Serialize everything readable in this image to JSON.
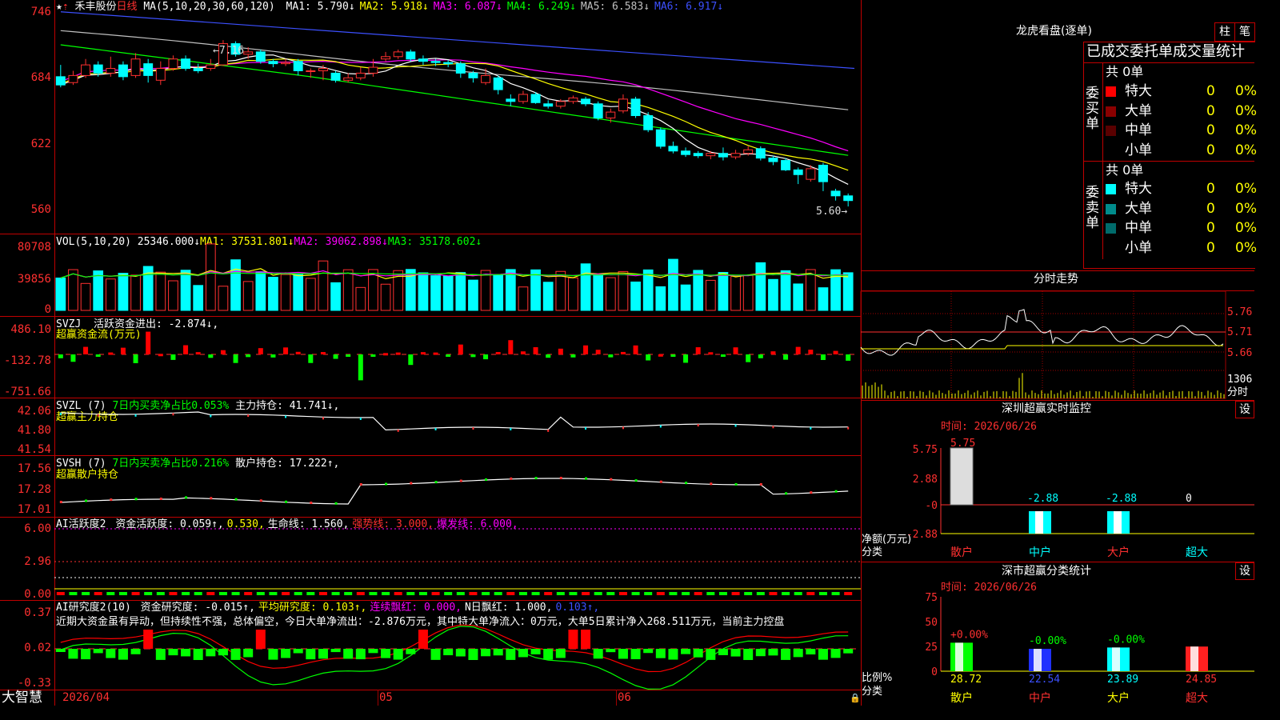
{
  "stock": {
    "name": "禾丰股份",
    "period": "日线"
  },
  "header_ma": {
    "label": "MA(5,10,20,30,60,120)",
    "items": [
      {
        "text": "MA1: 5.790↓",
        "color": "#ffffff"
      },
      {
        "text": "MA2: 5.918↓",
        "color": "#ffff00"
      },
      {
        "text": "MA3: 6.087↓",
        "color": "#ff00ff"
      },
      {
        "text": "MA4: 6.249↓",
        "color": "#00ff00"
      },
      {
        "text": "MA5: 6.583↓",
        "color": "#c0c0c0"
      },
      {
        "text": "MA6: 6.917↓",
        "color": "#3c50ff"
      }
    ]
  },
  "price_axis": [
    "746",
    "684",
    "622",
    "560"
  ],
  "price_marks": {
    "high": "7.16",
    "low": "5.60"
  },
  "vol": {
    "label": "VOL(5,10,20)",
    "value": "25346.000↓",
    "ma": [
      {
        "text": "MA1: 37531.801↓",
        "color": "#ffff00"
      },
      {
        "text": "MA2: 39062.898↓",
        "color": "#ff00ff"
      },
      {
        "text": "MA3: 35178.602↓",
        "color": "#00ff00"
      }
    ],
    "axis": [
      "80708",
      "39856",
      "0"
    ]
  },
  "svzj": {
    "label": "SVZJ",
    "item": "活跃资金进出: -2.874↓,",
    "subtitle": "超赢资金流(万元)",
    "axis": [
      "486.10",
      "-132.78",
      "-751.66"
    ]
  },
  "svzl": {
    "label": "SVZL (7)",
    "item1": "7日内买卖净占比0.053%",
    "item2": "主力持仓: 41.741↓,",
    "subtitle": "超赢主力持仓",
    "axis": [
      "42.06",
      "41.80",
      "41.54"
    ]
  },
  "svsh": {
    "label": "SVSH (7)",
    "item1": "7日内买卖净占比0.216%",
    "item2": "散户持仓: 17.222↑,",
    "subtitle": "超赢散户持仓",
    "axis": [
      "17.56",
      "17.28",
      "17.01"
    ]
  },
  "ai1": {
    "label": "AI活跃度2",
    "items": [
      {
        "text": "资金活跃度: 0.059↑,",
        "color": "#ffffff"
      },
      {
        "text": "0.530,",
        "color": "#ffff00"
      },
      {
        "text": "生命线: 1.560,",
        "color": "#ffffff"
      },
      {
        "text": "强势线: 3.000,",
        "color": "#ff3030"
      },
      {
        "text": "爆发线: 6.000,",
        "color": "#ff00ff"
      }
    ],
    "axis": [
      "6.00",
      "2.96",
      "0.00"
    ]
  },
  "ai2": {
    "label": "AI研究度2(10)",
    "items": [
      {
        "text": "资金研究度: -0.015↑,",
        "color": "#ffffff"
      },
      {
        "text": "平均研究度: 0.103↑,",
        "color": "#ffff00"
      },
      {
        "text": "连续飘红: 0.000,",
        "color": "#ff00ff"
      },
      {
        "text": "N日飘红: 1.000,",
        "color": "#ffffff"
      },
      {
        "text": "0.103↑,",
        "color": "#3c50ff"
      }
    ],
    "comment": "近期大资金虽有异动，但持续性不强，总体偏空，今日大单净流出：-2.876万元，其中特大单净流入：0万元，大单5日累计净入268.511万元，当前主力控盘",
    "axis": [
      "0.37",
      "0.02",
      "-0.33"
    ]
  },
  "date_axis": [
    "2026/04",
    "05",
    "06"
  ],
  "brand": "大智慧",
  "dragon": {
    "title": "龙虎看盘(逐单)",
    "btn1": "柱",
    "btn2": "笔",
    "header": "已成交委托单成交量统计",
    "buy": {
      "side_label": "委买单",
      "total": "共 0单",
      "rows": [
        {
          "name": "特大",
          "count": "0",
          "pct": "0%",
          "color": "#ff0000"
        },
        {
          "name": "大单",
          "count": "0",
          "pct": "0%",
          "color": "#8b0000"
        },
        {
          "name": "中单",
          "count": "0",
          "pct": "0%",
          "color": "#5a0000"
        },
        {
          "name": "小单",
          "count": "0",
          "pct": "0%",
          "color": "#000000"
        }
      ]
    },
    "sell": {
      "side_label": "委卖单",
      "total": "共 0单",
      "rows": [
        {
          "name": "特大",
          "count": "0",
          "pct": "0%",
          "color": "#00ffff"
        },
        {
          "name": "大单",
          "count": "0",
          "pct": "0%",
          "color": "#008b8b"
        },
        {
          "name": "中单",
          "count": "0",
          "pct": "0%",
          "color": "#006b6b"
        },
        {
          "name": "小单",
          "count": "0",
          "pct": "0%",
          "color": "#000000"
        }
      ]
    }
  },
  "intraday": {
    "title": "分时走势",
    "axis": [
      "5.76",
      "5.71",
      "5.66"
    ],
    "vol_label": "1306",
    "vol_unit": "分时"
  },
  "monitor": {
    "title": "深圳超赢实时监控",
    "settings": "设",
    "time": "时间: 2026/06/26",
    "axis": [
      "5.75",
      "2.88",
      "-0",
      "-2.88"
    ],
    "ylabel": "净额(万元)",
    "xlabel": "分类",
    "bars": [
      {
        "cat": "散户",
        "value": 5.75,
        "label": "5.75",
        "color": "#ffffff"
      },
      {
        "cat": "中户",
        "value": -2.88,
        "label": "-2.88",
        "color": "#00ffff"
      },
      {
        "cat": "大户",
        "value": -2.88,
        "label": "-2.88",
        "color": "#00ffff"
      },
      {
        "cat": "超大",
        "value": 0,
        "label": "0",
        "color": "#ffffff"
      }
    ]
  },
  "classify": {
    "title": "深市超赢分类统计",
    "settings": "设",
    "time": "时间: 2026/06/26",
    "axis": [
      "75",
      "50",
      "25",
      "0"
    ],
    "ylabel": "比例%",
    "xlabel": "分类",
    "bars": [
      {
        "cat": "散户",
        "value": 28.72,
        "label": "28.72",
        "top": "+0.00%",
        "color": "#00ff00",
        "cat_color": "#ffff00"
      },
      {
        "cat": "中户",
        "value": 22.54,
        "label": "22.54",
        "top": "-0.00%",
        "color": "#0000ff",
        "cat_color": "#ff3030"
      },
      {
        "cat": "大户",
        "value": 23.89,
        "label": "23.89",
        "top": "-0.00%",
        "color": "#00ffff",
        "cat_color": "#ffff00"
      },
      {
        "cat": "超大",
        "value": 24.85,
        "label": "24.85",
        "top": "",
        "color": "#ff0000",
        "cat_color": "#ff3030"
      }
    ]
  },
  "chart_data": {
    "type": "candlestick",
    "ylim": [
      5.52,
      7.5
    ],
    "candles": [
      [
        6.85,
        6.78,
        6.95,
        6.76
      ],
      [
        6.8,
        6.86,
        6.9,
        6.78
      ],
      [
        6.86,
        6.95,
        7.0,
        6.84
      ],
      [
        6.95,
        6.88,
        6.98,
        6.85
      ],
      [
        6.88,
        6.92,
        7.02,
        6.85
      ],
      [
        6.95,
        6.85,
        6.98,
        6.82
      ],
      [
        6.86,
        7.0,
        7.05,
        6.84
      ],
      [
        6.96,
        6.86,
        7.0,
        6.8
      ],
      [
        6.82,
        6.92,
        6.98,
        6.78
      ],
      [
        6.92,
        7.0,
        7.03,
        6.9
      ],
      [
        7.0,
        6.92,
        7.03,
        6.9
      ],
      [
        6.92,
        6.9,
        6.96,
        6.88
      ],
      [
        6.92,
        6.95,
        7.0,
        6.9
      ],
      [
        6.95,
        7.13,
        7.16,
        6.94
      ],
      [
        7.13,
        7.04,
        7.15,
        7.02
      ],
      [
        7.04,
        7.06,
        7.1,
        7.0
      ],
      [
        7.06,
        6.98,
        7.08,
        6.96
      ],
      [
        6.98,
        6.96,
        7.0,
        6.93
      ],
      [
        6.96,
        6.97,
        7.0,
        6.94
      ],
      [
        6.98,
        6.9,
        7.0,
        6.86
      ],
      [
        6.9,
        6.9,
        6.92,
        6.84
      ],
      [
        6.9,
        6.92,
        6.95,
        6.82
      ],
      [
        6.88,
        6.82,
        6.9,
        6.8
      ],
      [
        6.82,
        6.84,
        6.88,
        6.8
      ],
      [
        6.84,
        6.88,
        6.93,
        6.82
      ],
      [
        6.88,
        6.93,
        7.0,
        6.85
      ],
      [
        7.0,
        7.02,
        7.06,
        6.98
      ],
      [
        7.02,
        7.06,
        7.08,
        7.0
      ],
      [
        7.06,
        7.0,
        7.08,
        6.98
      ],
      [
        7.0,
        6.98,
        7.03,
        6.95
      ],
      [
        6.98,
        6.97,
        7.0,
        6.94
      ],
      [
        6.97,
        6.96,
        6.99,
        6.93
      ],
      [
        6.96,
        6.88,
        6.98,
        6.84
      ],
      [
        6.88,
        6.84,
        6.9,
        6.8
      ],
      [
        6.8,
        6.86,
        6.92,
        6.78
      ],
      [
        6.84,
        6.74,
        6.86,
        6.7
      ],
      [
        6.66,
        6.64,
        6.7,
        6.6
      ],
      [
        6.64,
        6.7,
        6.73,
        6.62
      ],
      [
        6.7,
        6.63,
        6.72,
        6.62
      ],
      [
        6.62,
        6.6,
        6.65,
        6.58
      ],
      [
        6.6,
        6.64,
        6.66,
        6.58
      ],
      [
        6.64,
        6.67,
        6.69,
        6.62
      ],
      [
        6.66,
        6.62,
        6.68,
        6.6
      ],
      [
        6.62,
        6.5,
        6.64,
        6.48
      ],
      [
        6.5,
        6.55,
        6.58,
        6.46
      ],
      [
        6.56,
        6.66,
        6.7,
        6.54
      ],
      [
        6.66,
        6.52,
        6.68,
        6.5
      ],
      [
        6.52,
        6.4,
        6.55,
        6.38
      ],
      [
        6.4,
        6.26,
        6.42,
        6.24
      ],
      [
        6.26,
        6.22,
        6.3,
        6.2
      ],
      [
        6.22,
        6.19,
        6.25,
        6.17
      ],
      [
        6.2,
        6.18,
        6.22,
        6.16
      ],
      [
        6.18,
        6.2,
        6.22,
        6.15
      ],
      [
        6.2,
        6.17,
        6.25,
        6.14
      ],
      [
        6.17,
        6.2,
        6.23,
        6.15
      ],
      [
        6.2,
        6.23,
        6.26,
        6.18
      ],
      [
        6.24,
        6.16,
        6.26,
        6.14
      ],
      [
        6.16,
        6.13,
        6.18,
        6.1
      ],
      [
        6.14,
        6.06,
        6.16,
        6.05
      ],
      [
        6.06,
        6.02,
        6.08,
        5.94
      ],
      [
        5.98,
        6.07,
        6.1,
        5.96
      ],
      [
        6.1,
        5.96,
        6.12,
        5.88
      ],
      [
        5.88,
        5.84,
        5.9,
        5.8
      ],
      [
        5.84,
        5.8,
        5.86,
        5.75
      ]
    ]
  }
}
